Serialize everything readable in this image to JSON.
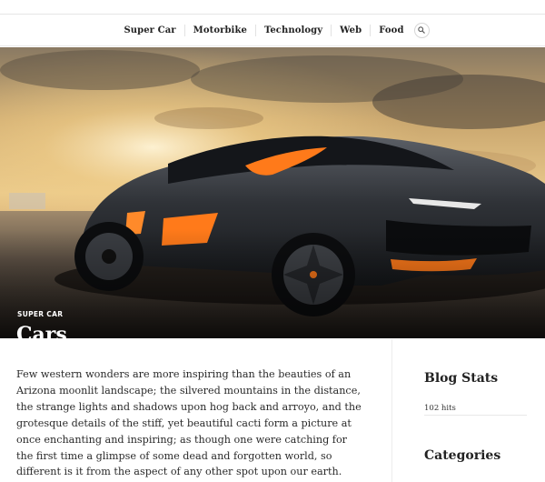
{
  "nav": {
    "items": [
      {
        "label": "Super Car"
      },
      {
        "label": "Motorbike"
      },
      {
        "label": "Technology"
      },
      {
        "label": "Web"
      },
      {
        "label": "Food"
      }
    ],
    "search_icon": "search-icon"
  },
  "hero": {
    "category": "SUPER CAR",
    "title": "Cars"
  },
  "article": {
    "text": "Few western wonders are more inspiring than the beauties of an Arizona moonlit landscape; the silvered mountains in the distance, the strange lights and shadows upon hog back and arroyo, and the grotesque details of the stiff, yet beautiful cacti form a picture at once enchanting and inspiring; as though one were catching for the first time a glimpse of some dead and forgotten world, so different is it from the aspect of any other spot upon our earth."
  },
  "sidebar": {
    "stats_title": "Blog Stats",
    "hits": "102 hits",
    "categories_title": "Categories"
  },
  "colors": {
    "accent_orange": "#ff7a1a",
    "car_body": "#2e3136",
    "sky_gold": "#e8b45a"
  }
}
